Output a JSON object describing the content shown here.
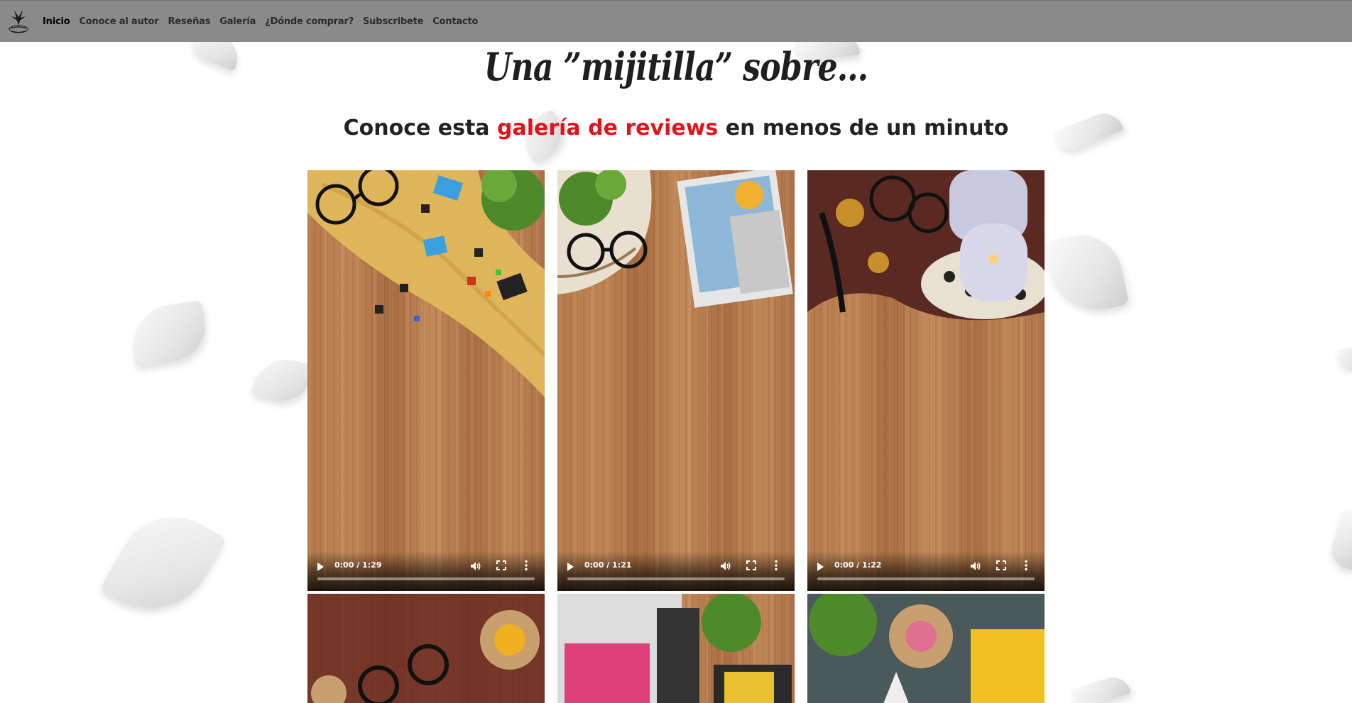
{
  "nav": {
    "logo_alt": "La Pluma del Cuervo",
    "items": [
      {
        "label": "Inicio",
        "active": true
      },
      {
        "label": "Conoce al autor",
        "active": false
      },
      {
        "label": "Reseñas",
        "active": false
      },
      {
        "label": "Galería",
        "active": false
      },
      {
        "label": "¿Dónde comprar?",
        "active": false
      },
      {
        "label": "Subscribete",
        "active": false
      },
      {
        "label": "Contacto",
        "active": false
      }
    ]
  },
  "hero": {
    "title": "Una ”mijitilla” sobre…",
    "subtitle_before": "Conoce esta ",
    "subtitle_accent": "galería de reviews",
    "subtitle_after": " en menos de un minuto",
    "accent_color": "#e1141e"
  },
  "videos": [
    {
      "time": "0:00 / 1:29",
      "progress": 0
    },
    {
      "time": "0:00 / 1:21",
      "progress": 0
    },
    {
      "time": "0:00 / 1:22",
      "progress": 0
    },
    {
      "time": "",
      "progress": 0
    },
    {
      "time": "",
      "progress": 0
    },
    {
      "time": "",
      "progress": 0
    }
  ],
  "icons": {
    "play": "play-icon",
    "volume": "volume-icon",
    "fullscreen": "fullscreen-icon",
    "more": "more-options-icon"
  },
  "colors": {
    "navbar": "#8a8a8a",
    "accent": "#e1141e"
  }
}
